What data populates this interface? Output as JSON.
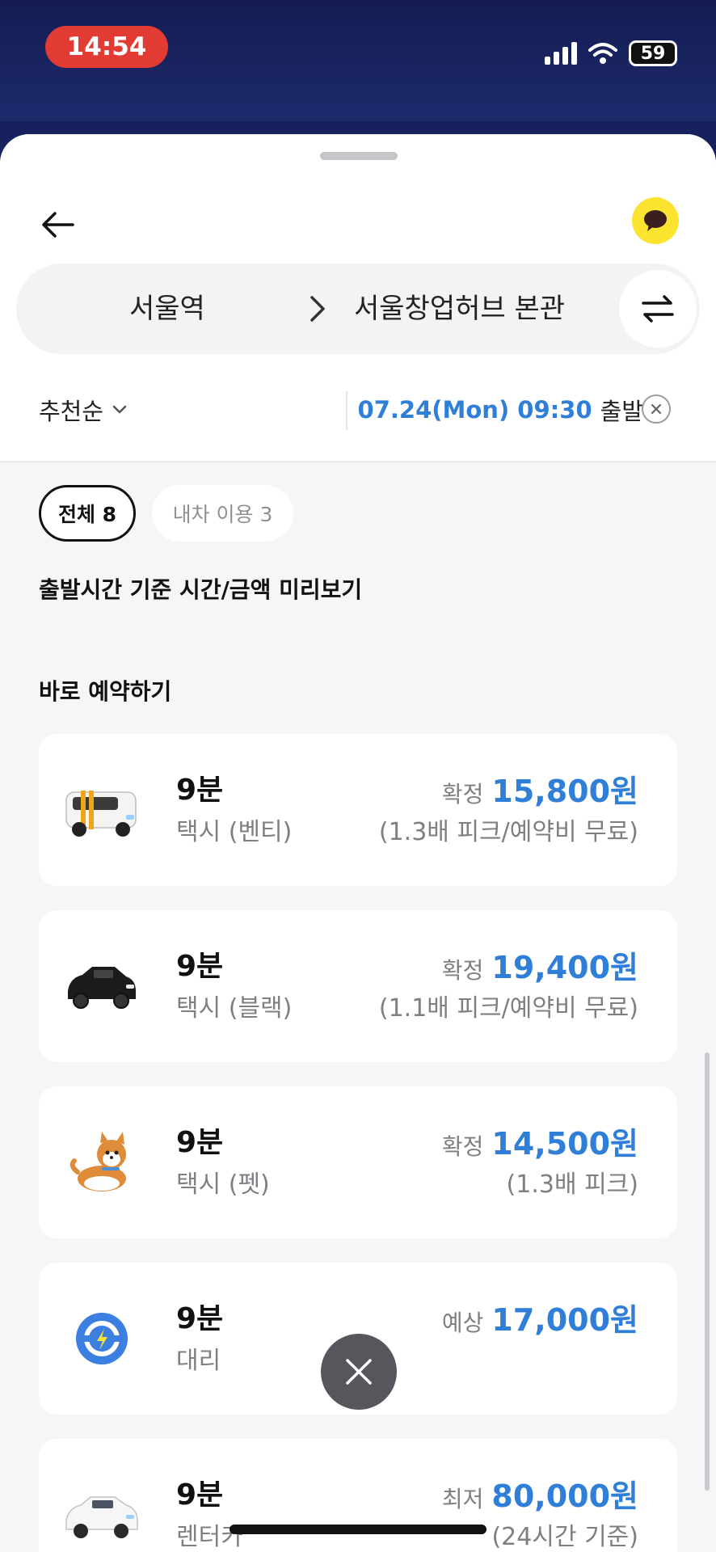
{
  "status_bar": {
    "time": "14:54",
    "battery": "59"
  },
  "header": {
    "origin": "서울역",
    "destination": "서울창업허브 본관"
  },
  "filters": {
    "sort": "추천순",
    "departure_datetime": "07.24(Mon) 09:30",
    "departure_suffix": "출발"
  },
  "chips": [
    {
      "label": "전체 8",
      "selected": true
    },
    {
      "label": "내차 이용 3",
      "selected": false
    }
  ],
  "sections": {
    "preview_title": "출발시간 기준 시간/금액 미리보기",
    "book_now_title": "바로 예약하기"
  },
  "options": [
    {
      "icon": "venti-taxi-icon",
      "eta": "9분",
      "kind": "택시 (벤티)",
      "price_label": "확정",
      "price": "15,800원",
      "note": "(1.3배 피크/예약비 무료)"
    },
    {
      "icon": "black-taxi-icon",
      "eta": "9분",
      "kind": "택시 (블랙)",
      "price_label": "확정",
      "price": "19,400원",
      "note": "(1.1배 피크/예약비 무료)"
    },
    {
      "icon": "pet-taxi-dog-icon",
      "eta": "9분",
      "kind": "택시 (펫)",
      "price_label": "확정",
      "price": "14,500원",
      "note": "(1.3배 피크)"
    },
    {
      "icon": "steering-wheel-icon",
      "eta": "9분",
      "kind": "대리",
      "price_label": "예상",
      "price": "17,000원",
      "note": ""
    },
    {
      "icon": "rental-car-icon",
      "eta": "9분",
      "kind": "렌터카",
      "price_label": "최저",
      "price": "80,000원",
      "note": "(24시간 기준)"
    }
  ],
  "colors": {
    "accent_blue": "#2f7ed8",
    "kakao_yellow": "#fce330",
    "time_pill_red": "#e23b33"
  }
}
